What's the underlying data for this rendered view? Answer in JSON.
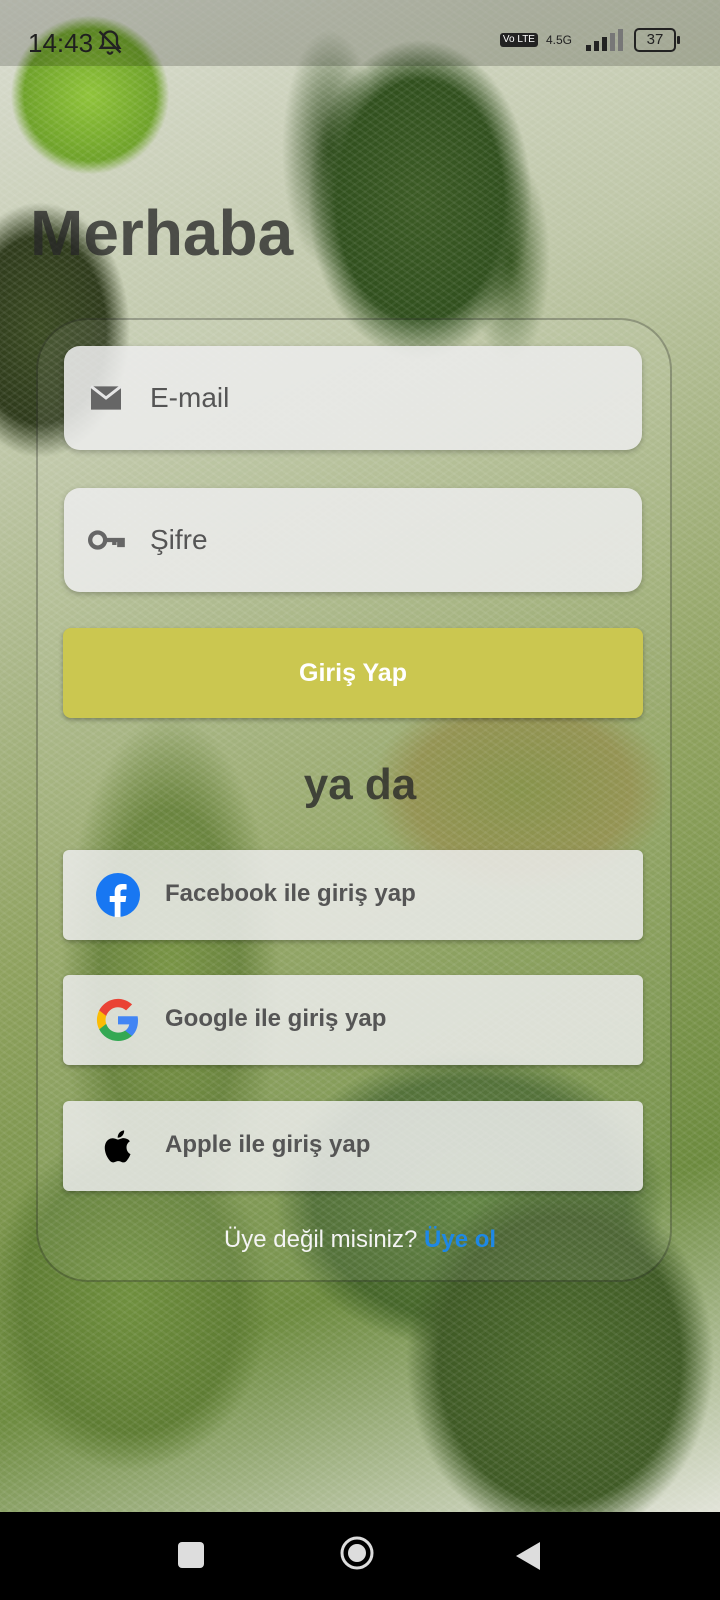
{
  "status_bar": {
    "time": "14:43",
    "volte": "Vo LTE",
    "network": "4.5G",
    "battery": "37"
  },
  "greeting": "Merhaba",
  "form": {
    "email_placeholder": "E-mail",
    "password_placeholder": "Şifre",
    "login_label": "Giriş Yap"
  },
  "divider_text": "ya da",
  "social": {
    "facebook_label": "Facebook ile giriş yap",
    "google_label": "Google ile giriş yap",
    "apple_label": "Apple ile giriş yap"
  },
  "signup": {
    "prompt": "Üye değil misiniz?",
    "link": "Üye ol"
  },
  "colors": {
    "login_button": "#cbc750",
    "link": "#1e88e5",
    "facebook": "#1877f2"
  },
  "icons": [
    "bell-off-icon",
    "signal-icon",
    "battery-icon",
    "mail-icon",
    "key-icon",
    "facebook-icon",
    "google-icon",
    "apple-icon",
    "recents-icon",
    "home-icon",
    "back-icon"
  ]
}
